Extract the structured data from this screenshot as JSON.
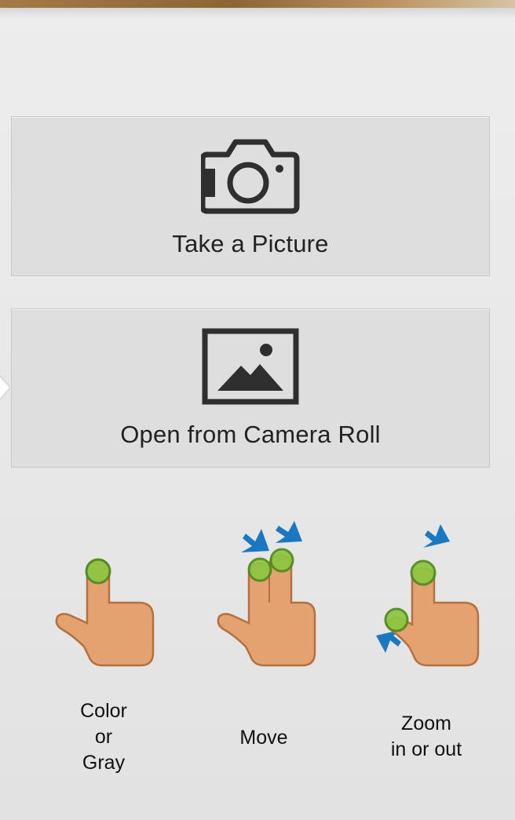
{
  "actions": {
    "take_picture": {
      "label": "Take a Picture",
      "icon": "camera-icon"
    },
    "open_camera_roll": {
      "label": "Open from Camera Roll",
      "icon": "photo-icon"
    }
  },
  "gestures": [
    {
      "icon": "one-finger-tap-icon",
      "lines": [
        "Color",
        "or",
        "Gray"
      ]
    },
    {
      "icon": "two-finger-move-icon",
      "lines": [
        "Move"
      ]
    },
    {
      "icon": "pinch-zoom-icon",
      "lines": [
        "Zoom",
        "in or out"
      ]
    }
  ],
  "colors": {
    "hand": "#e3a270",
    "hand_outline": "#b5703d",
    "touch_point": "#8cc63f",
    "arrow": "#1a78c2",
    "icon": "#2f2f2f"
  }
}
